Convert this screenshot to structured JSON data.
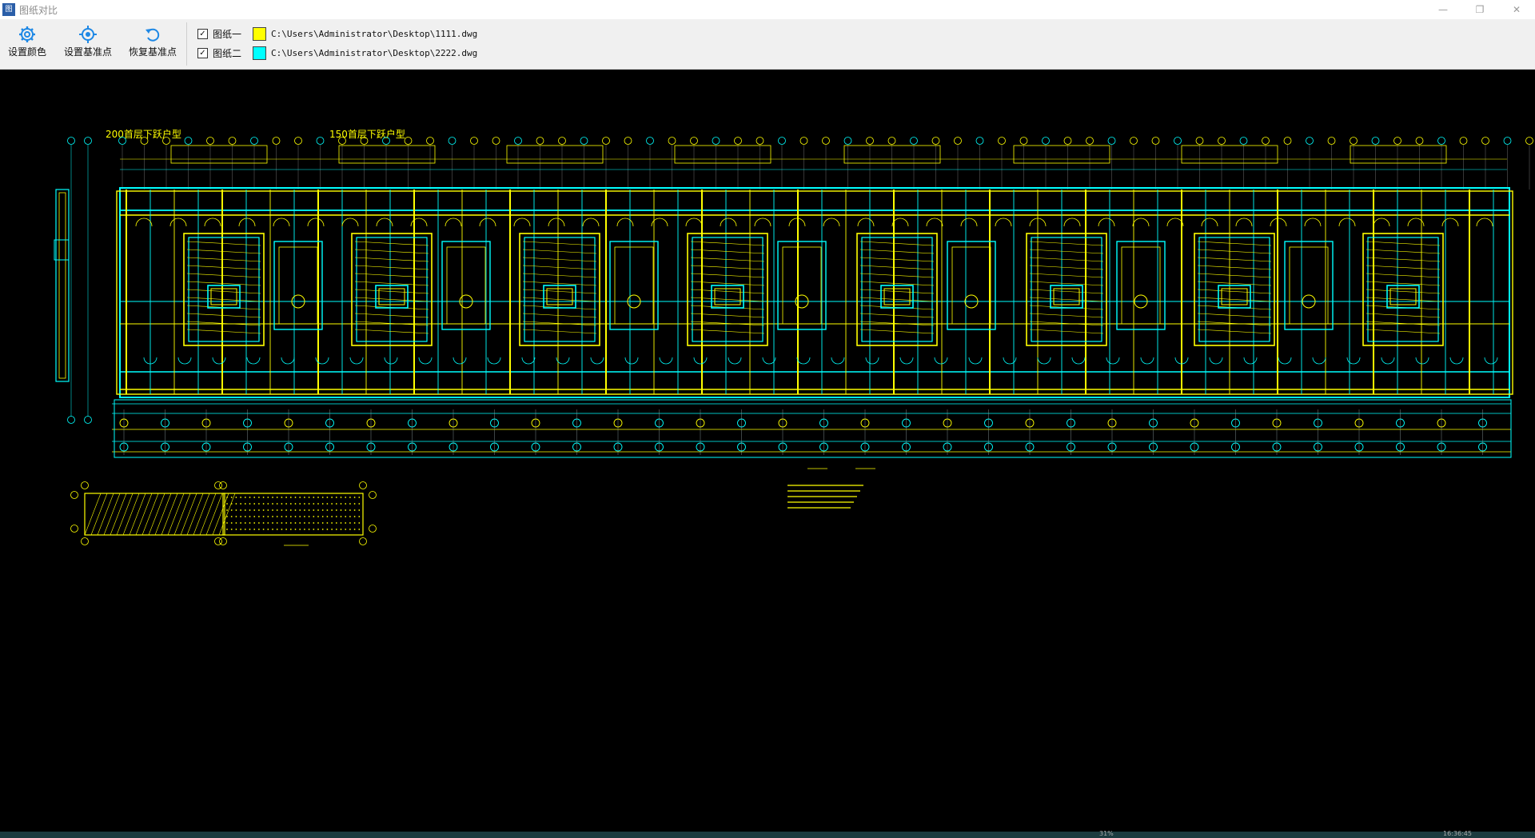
{
  "window": {
    "title": "图纸对比",
    "app_icon_text": "图",
    "minimize_label": "—",
    "restore_label": "❐",
    "close_label": "✕"
  },
  "toolbar": {
    "set_color_label": "设置颜色",
    "set_basepoint_label": "设置基准点",
    "restore_basepoint_label": "恢复基准点"
  },
  "files": [
    {
      "label": "图纸一",
      "checked": true,
      "color": "#ffff00",
      "path": "C:\\Users\\Administrator\\Desktop\\1111.dwg"
    },
    {
      "label": "图纸二",
      "checked": true,
      "color": "#00ffff",
      "path": "C:\\Users\\Administrator\\Desktop\\2222.dwg"
    }
  ],
  "drawing": {
    "label_left": "200首层下跃户型",
    "label_right": "150首层下跃户型",
    "colors": {
      "drawing1": "#ffff00",
      "drawing2": "#00ffff",
      "background": "#000000"
    }
  },
  "statusbar": {
    "zoom": "31%",
    "time": "16:36:45"
  }
}
